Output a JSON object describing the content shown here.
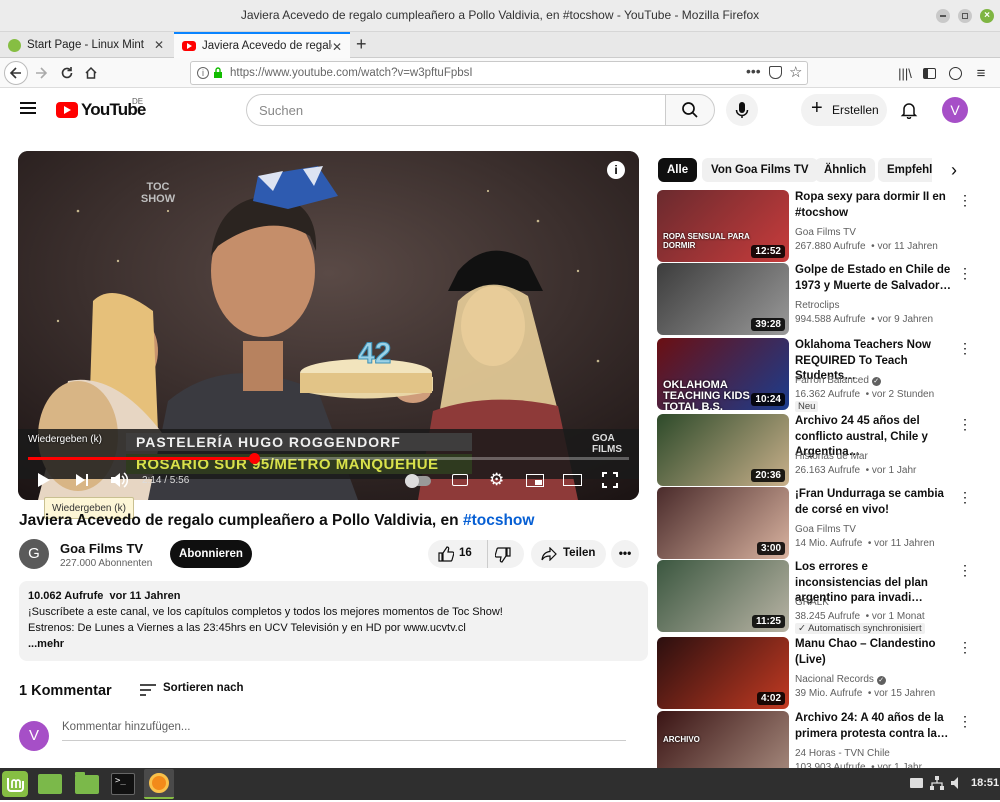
{
  "window": {
    "title": "Javiera Acevedo de regalo cumpleañero a Pollo Valdivia, en #tocshow - YouTube - Mozilla Firefox"
  },
  "tabs": [
    {
      "label": "Start Page - Linux Mint",
      "icon": "linux-mint-icon",
      "active": false
    },
    {
      "label": "Javiera Acevedo de regalo c",
      "icon": "youtube-icon",
      "active": true
    }
  ],
  "urlbar": {
    "url": "https://www.youtube.com/watch?v=w3pftuFpbsI"
  },
  "youtube": {
    "logo": "YouTube",
    "region": "DE",
    "search_placeholder": "Suchen",
    "create_label": "Erstellen",
    "avatar_letter": "V"
  },
  "player": {
    "overlay_logo": "TOC SHOW",
    "banner_line1": "PASTELERÍA HUGO ROGGENDORF",
    "banner_line2": "ROSARIO SUR 95/METRO MANQUEHUE",
    "watermark": "GOA FILMS",
    "tooltip_top": "Wiedergeben (k)",
    "tooltip_bottom": "Wiedergeben (k)",
    "time": "2:14 / 5:56",
    "progress": 0.376,
    "cake_number": "42",
    "crown_text": "42"
  },
  "video": {
    "title": "Javiera Acevedo de regalo cumpleañero a Pollo Valdivia, en",
    "hashtag": "#tocshow",
    "channel": "Goa Films TV",
    "channel_initial": "G",
    "subscribers": "227.000 Abonnenten",
    "subscribe_label": "Abonnieren",
    "likes": "16",
    "share_label": "Teilen"
  },
  "description": {
    "views_date": "10.062 Aufrufe  vor 11 Jahren",
    "line1": "¡Suscríbete a este canal, ve los capítulos completos y todos los mejores momentos de Toc Show!",
    "line2": "Estrenos: De Lunes a Viernes a las 23:45hrs en UCV Televisión y en HD por www.ucvtv.cl",
    "more": "...mehr"
  },
  "comments": {
    "count_label": "1 Kommentar",
    "sort_label": "Sortieren nach",
    "placeholder": "Kommentar hinzufügen...",
    "avatar_letter": "V"
  },
  "chips": [
    "Alle",
    "Von Goa Films TV",
    "Ähnlich",
    "Empfehlu"
  ],
  "recommendations": [
    {
      "title": "Ropa sexy para dormir II en #tocshow",
      "channel": "Goa Films TV",
      "meta": "267.880 Aufrufe  • vor 11 Jahren",
      "duration": "12:52",
      "thumb_text": "ROPA SENSUAL PARA DORMIR"
    },
    {
      "title": "Golpe de Estado en Chile de 1973 y Muerte de Salvador…",
      "channel": "Retroclips",
      "meta": "994.588 Aufrufe  • vor 9 Jahren",
      "duration": "39:28"
    },
    {
      "title": "Oklahoma Teachers Now REQUIRED To Teach Students…",
      "channel": "Farron Balanced",
      "meta": "16.362 Aufrufe  • vor 2 Stunden",
      "badge": "Neu",
      "duration": "10:24",
      "thumb_text": "OKLAHOMA TEACHING KIDS TOTAL B.S."
    },
    {
      "title": "Archivo 24 45 años del conflicto austral, Chile y Argentina…",
      "channel": "Historias de Mar",
      "meta": "26.163 Aufrufe  • vor 1 Jahr",
      "duration": "20:36"
    },
    {
      "title": "¡Fran Undurraga se cambia de corsé en vivo!",
      "channel": "Goa Films TV",
      "meta": "14 Mio. Aufrufe  • vor 11 Jahren",
      "duration": "3:00"
    },
    {
      "title": "Los errores e inconsistencias del plan argentino para invadi…",
      "channel": "GRALK",
      "meta": "38.245 Aufrufe  • vor 1 Monat",
      "badge": "Automatisch synchronisiert",
      "duration": "11:25"
    },
    {
      "title": "Manu Chao – Clandestino (Live)",
      "channel": "Nacional Records",
      "meta": "39 Mio. Aufrufe  • vor 15 Jahren",
      "duration": "4:02"
    },
    {
      "title": "Archivo 24: A 40 años de la primera protesta contra la…",
      "channel": "24 Horas - TVN Chile",
      "meta": "103.903 Aufrufe  • vor 1 Jahr",
      "duration": "",
      "thumb_text": "ARCHIVO"
    }
  ],
  "taskbar": {
    "clock": "18:51"
  }
}
